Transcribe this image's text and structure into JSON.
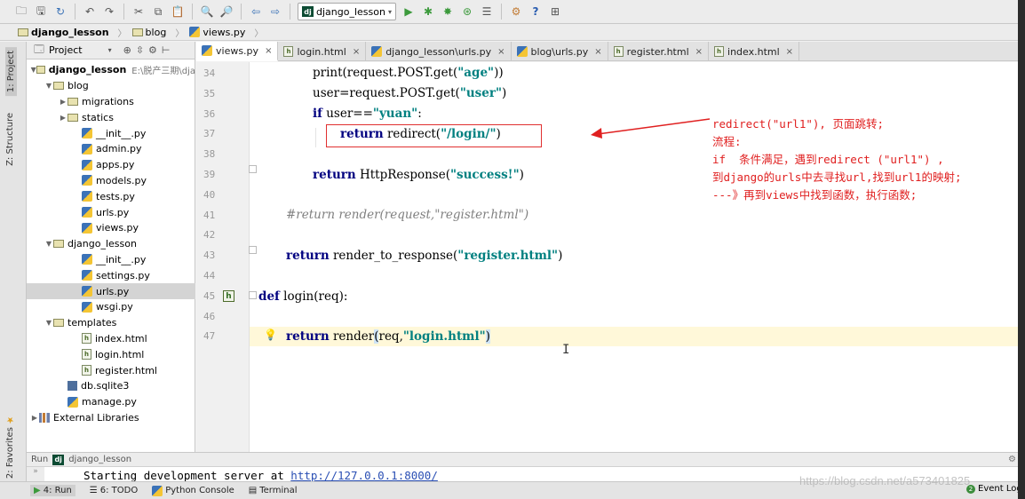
{
  "toolbar": {
    "run_config": "django_lesson",
    "icons": [
      "folder-open-icon",
      "save-icon",
      "sync-icon",
      "undo-icon",
      "redo-icon",
      "cut-icon",
      "copy-icon",
      "paste-icon",
      "find-icon",
      "replace-icon",
      "back-icon",
      "forward-icon",
      "run-icon",
      "debug-icon",
      "coverage-icon",
      "profile-icon",
      "tasks-icon",
      "vcs-icon",
      "help-icon",
      "structure-icon"
    ]
  },
  "breadcrumb": [
    "django_lesson",
    "blog",
    "views.py"
  ],
  "project_panel": {
    "title": "Project",
    "tree": [
      {
        "label": "django_lesson",
        "hint": "E:\\脱产三期\\dja",
        "type": "folder",
        "depth": 0,
        "open": true,
        "bold": true
      },
      {
        "label": "blog",
        "type": "folder",
        "depth": 1,
        "open": true
      },
      {
        "label": "migrations",
        "type": "folder",
        "depth": 2,
        "open": false
      },
      {
        "label": "statics",
        "type": "folder",
        "depth": 2,
        "open": false
      },
      {
        "label": "__init__.py",
        "type": "py",
        "depth": 3
      },
      {
        "label": "admin.py",
        "type": "py",
        "depth": 3
      },
      {
        "label": "apps.py",
        "type": "py",
        "depth": 3
      },
      {
        "label": "models.py",
        "type": "py",
        "depth": 3
      },
      {
        "label": "tests.py",
        "type": "py",
        "depth": 3
      },
      {
        "label": "urls.py",
        "type": "py",
        "depth": 3
      },
      {
        "label": "views.py",
        "type": "py",
        "depth": 3
      },
      {
        "label": "django_lesson",
        "type": "folder",
        "depth": 1,
        "open": true
      },
      {
        "label": "__init__.py",
        "type": "py",
        "depth": 3
      },
      {
        "label": "settings.py",
        "type": "py",
        "depth": 3
      },
      {
        "label": "urls.py",
        "type": "py",
        "depth": 3,
        "selected": true
      },
      {
        "label": "wsgi.py",
        "type": "py",
        "depth": 3
      },
      {
        "label": "templates",
        "type": "folder",
        "depth": 1,
        "open": true
      },
      {
        "label": "index.html",
        "type": "html",
        "depth": 3
      },
      {
        "label": "login.html",
        "type": "html",
        "depth": 3
      },
      {
        "label": "register.html",
        "type": "html",
        "depth": 3
      },
      {
        "label": "db.sqlite3",
        "type": "db",
        "depth": 2
      },
      {
        "label": "manage.py",
        "type": "py",
        "depth": 2
      },
      {
        "label": "External Libraries",
        "type": "lib",
        "depth": 0,
        "open": false
      }
    ]
  },
  "side_tabs": {
    "project": "1: Project",
    "structure": "Z: Structure",
    "favorites": "2: Favorites"
  },
  "editor_tabs": [
    {
      "label": "views.py",
      "type": "py",
      "active": true
    },
    {
      "label": "login.html",
      "type": "html"
    },
    {
      "label": "django_lesson\\urls.py",
      "type": "py"
    },
    {
      "label": "blog\\urls.py",
      "type": "py"
    },
    {
      "label": "register.html",
      "type": "html"
    },
    {
      "label": "index.html",
      "type": "html"
    }
  ],
  "code": {
    "line_numbers": [
      "34",
      "35",
      "36",
      "37",
      "38",
      "39",
      "40",
      "41",
      "42",
      "43",
      "44",
      "45",
      "46",
      "47"
    ]
  },
  "annotation": {
    "lines": [
      "redirect(\"url1\"), 页面跳转;",
      "流程:",
      "if  条件满足，遇到redirect (\"url1\") ,",
      "到django的urls中去寻找url,找到url1的映射;",
      "---》再到views中找到函数，执行函数;"
    ]
  },
  "run_panel": {
    "title": "Run",
    "config": "django_lesson",
    "output_prefix": "Starting development server at ",
    "output_link": "http://127.0.0.1:8000/"
  },
  "status_bar": {
    "tabs": [
      "4: Run",
      "6: TODO",
      "Python Console",
      "Terminal"
    ],
    "event_log": "Event Log",
    "watermark": "https://blog.csdn.net/a573401825"
  }
}
